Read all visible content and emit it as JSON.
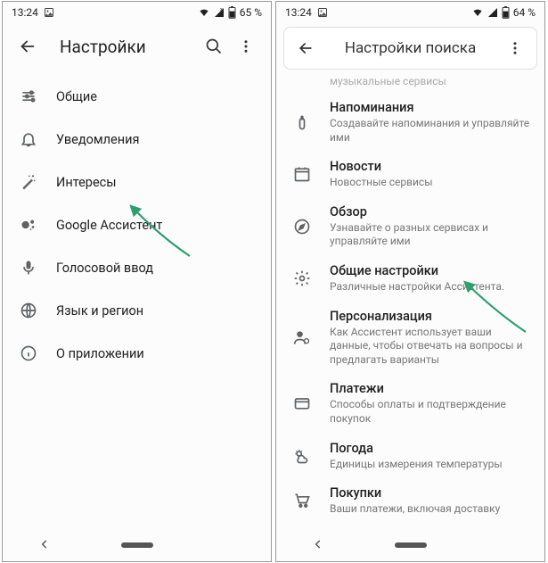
{
  "colors": {
    "arrow": "#2e9e6f"
  },
  "left": {
    "status": {
      "time": "13:24",
      "battery": "65 %"
    },
    "appbar": {
      "title": "Настройки"
    },
    "items": [
      {
        "icon": "sliders-icon",
        "label": "Общие"
      },
      {
        "icon": "bell-icon",
        "label": "Уведомления"
      },
      {
        "icon": "wand-icon",
        "label": "Интересы"
      },
      {
        "icon": "assistant-icon",
        "label": "Google Ассистент"
      },
      {
        "icon": "mic-icon",
        "label": "Голосовой ввод"
      },
      {
        "icon": "globe-icon",
        "label": "Язык и регион"
      },
      {
        "icon": "info-icon",
        "label": "О приложении"
      }
    ]
  },
  "right": {
    "status": {
      "time": "13:24",
      "battery": "64 %"
    },
    "appbar": {
      "title": "Настройки поиска"
    },
    "faded_top": "музыкальные сервисы",
    "items": [
      {
        "icon": "reminder-icon",
        "label": "Напоминания",
        "sub": "Создавайте напоминания и управляйте ими"
      },
      {
        "icon": "news-icon",
        "label": "Новости",
        "sub": "Новостные сервисы"
      },
      {
        "icon": "compass-icon",
        "label": "Обзор",
        "sub": "Узнавайте о разных сервисах и управляйте ими"
      },
      {
        "icon": "gear-icon",
        "label": "Общие настройки",
        "sub": "Различные настройки Ассистента."
      },
      {
        "icon": "person-icon",
        "label": "Персонализация",
        "sub": "Как Ассистент использует ваши данные, чтобы отвечать на вопросы и предлагать варианты"
      },
      {
        "icon": "card-icon",
        "label": "Платежи",
        "sub": "Способы оплаты и подтверждение покупок"
      },
      {
        "icon": "weather-icon",
        "label": "Погода",
        "sub": "Единицы измерения температуры"
      },
      {
        "icon": "cart-icon",
        "label": "Покупки",
        "sub": "Ваши платежи, включая доставку"
      }
    ]
  }
}
